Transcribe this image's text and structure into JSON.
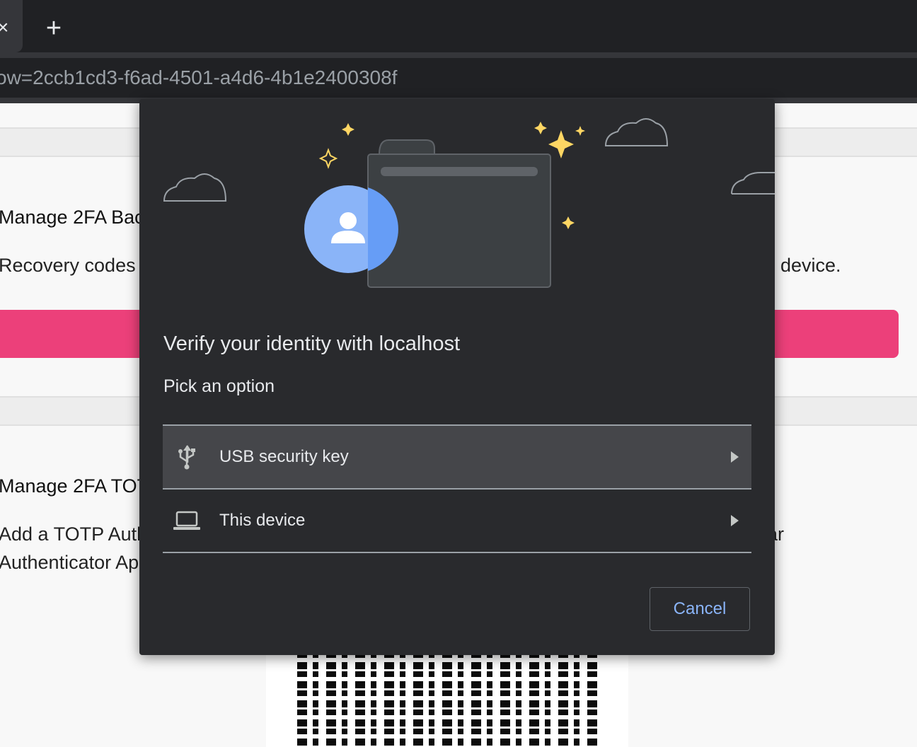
{
  "browser": {
    "tab_close_glyph": "×",
    "new_tab_glyph": "+",
    "url": "ow=2ccb1cd3-f6ad-4501-a4d6-4b1e2400308f"
  },
  "page": {
    "backup_heading": "Manage 2FA Bac",
    "backup_description_left": "Recovery codes",
    "backup_description_right": "device.",
    "totp_heading": "Manage 2FA TOT",
    "totp_line1_left": "Add a TOTP Auth",
    "totp_line1_right": "ar",
    "totp_line2_left": "Authenticator Ap",
    "accent_color": "#ec407a"
  },
  "dialog": {
    "title": "Verify your identity with localhost",
    "subtitle": "Pick an option",
    "options": [
      {
        "label": "USB security key",
        "icon": "usb-icon",
        "selected": true
      },
      {
        "label": "This device",
        "icon": "laptop-icon",
        "selected": false
      }
    ],
    "cancel_label": "Cancel",
    "link_color": "#8ab4f8"
  }
}
